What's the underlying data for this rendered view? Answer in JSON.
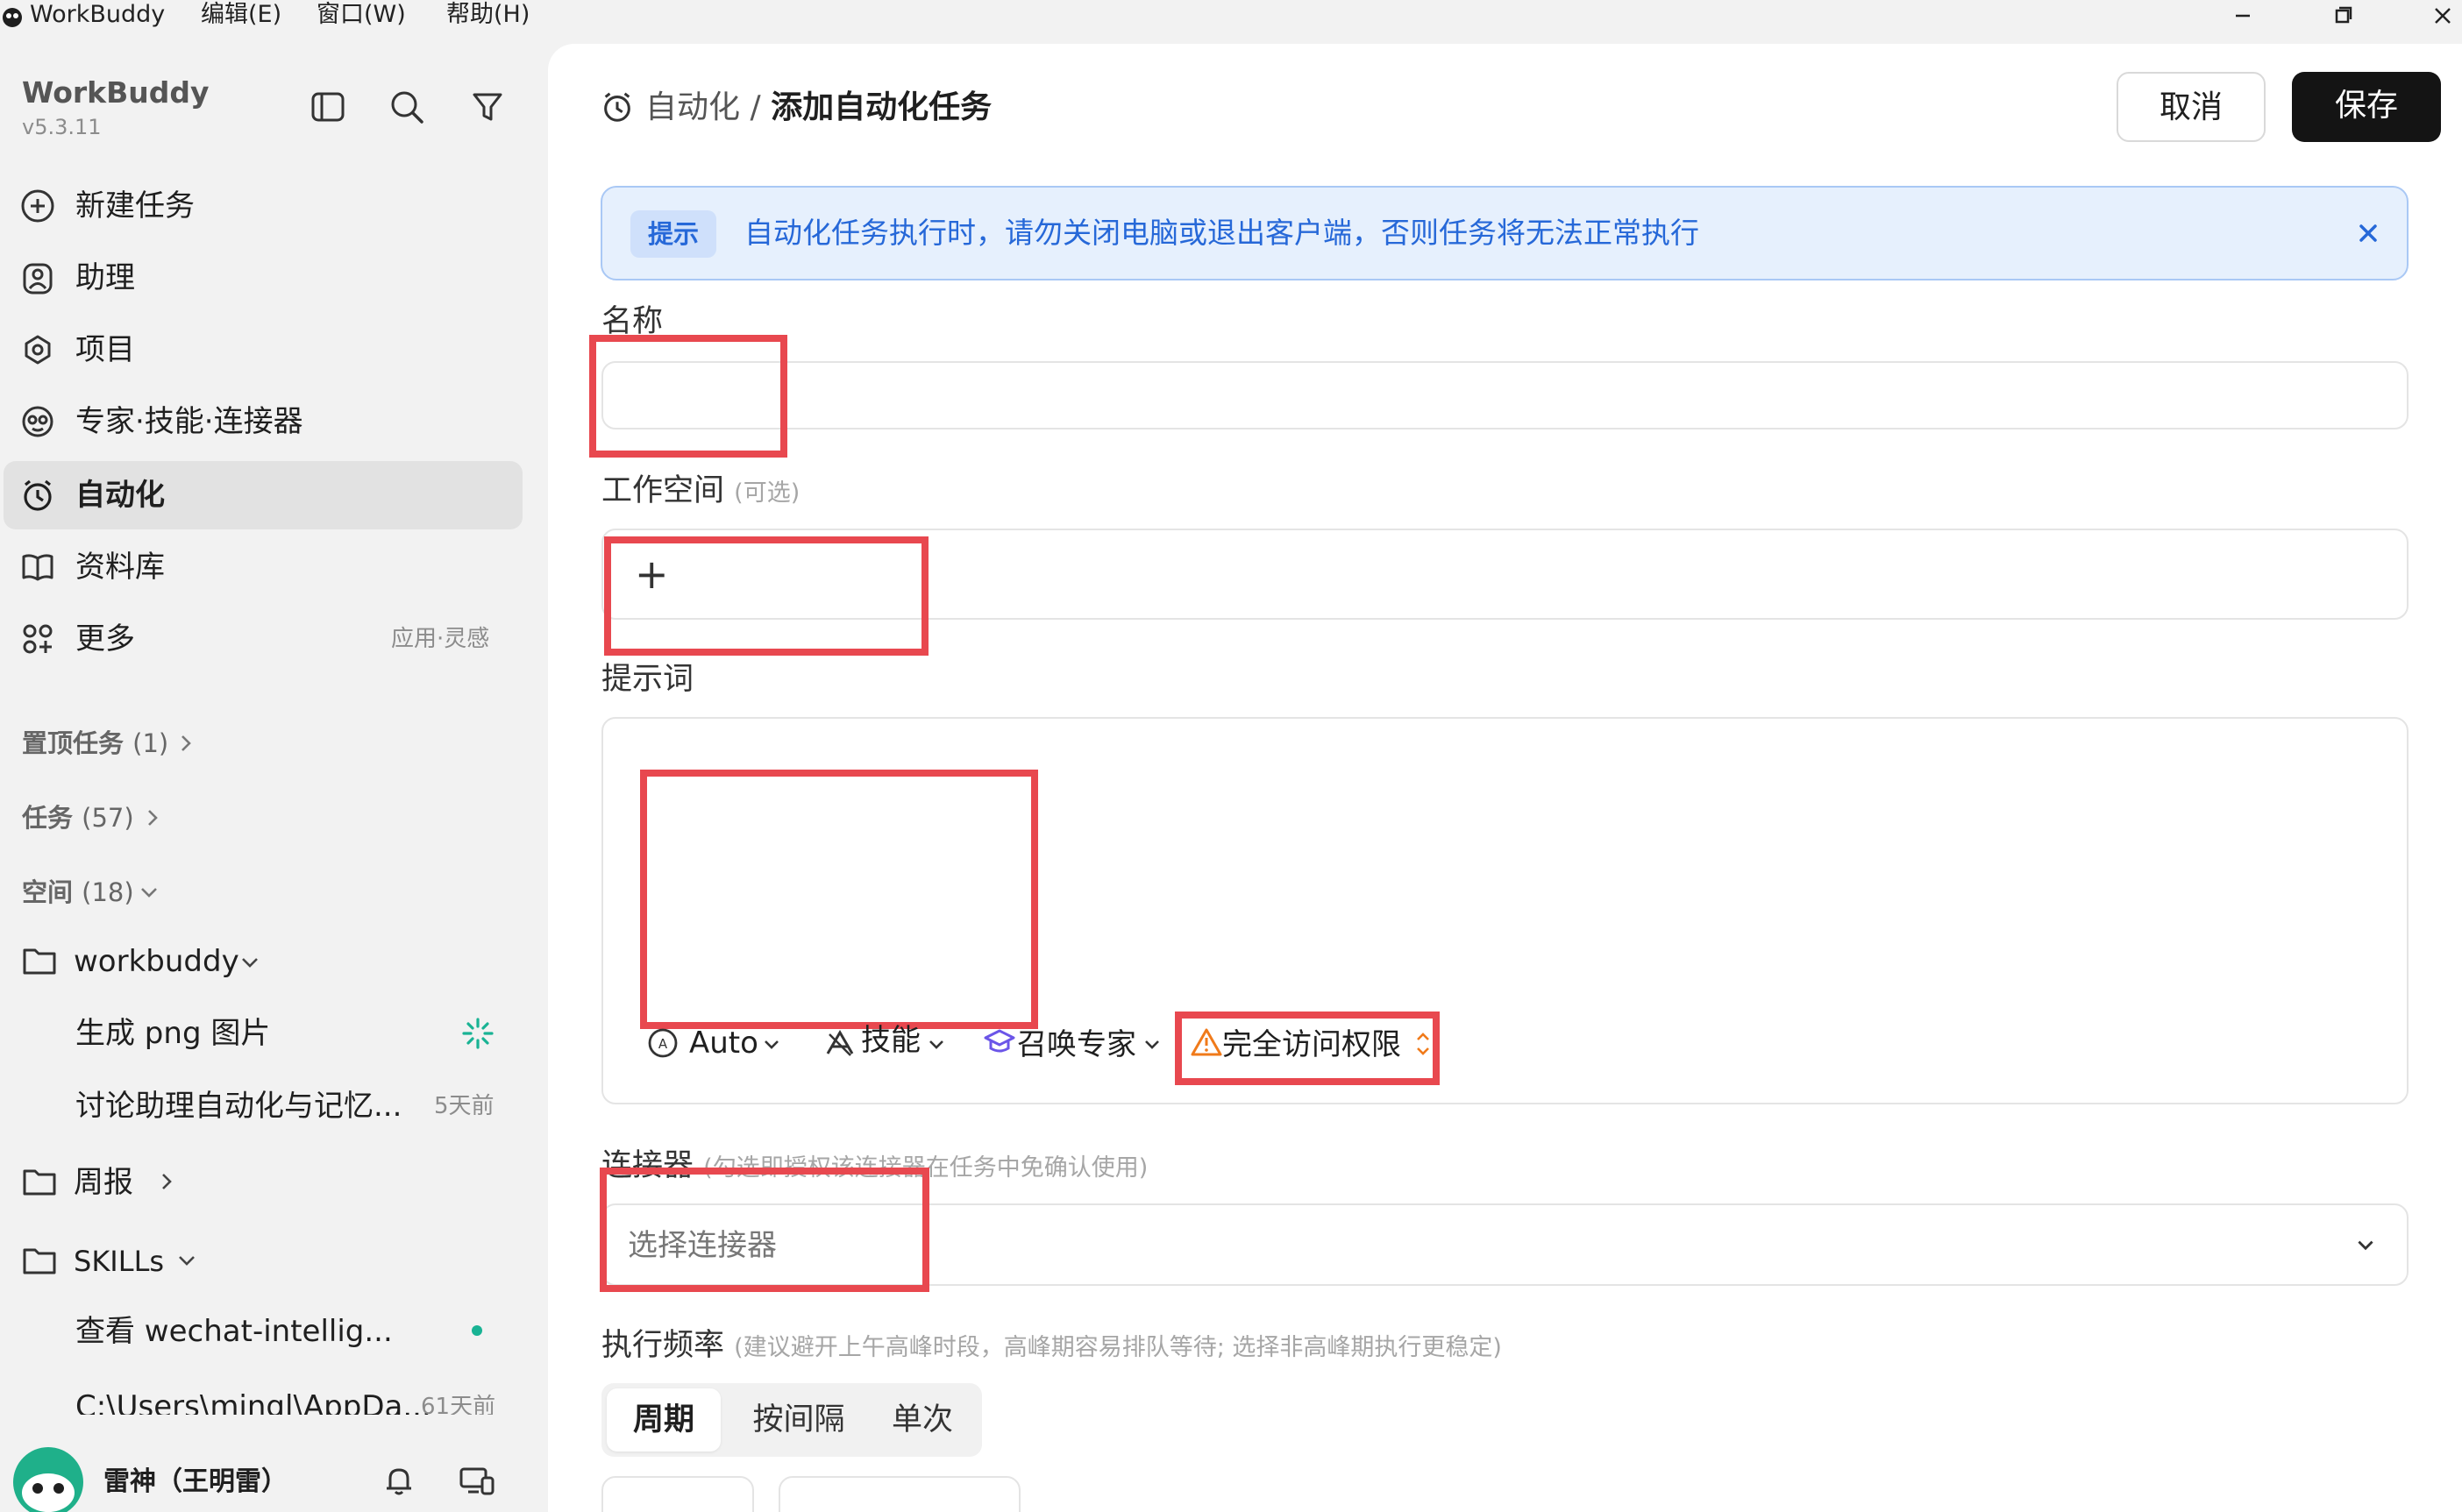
{
  "titlebar": {
    "app_name": "WorkBuddy",
    "menus": [
      "编辑(E)",
      "窗口(W)",
      "帮助(H)"
    ]
  },
  "sidebar": {
    "brand": "WorkBuddy",
    "version": "v5.3.11",
    "nav": [
      {
        "label": "新建任务",
        "icon": "plus-circle-icon"
      },
      {
        "label": "助理",
        "icon": "assistant-icon"
      },
      {
        "label": "项目",
        "icon": "project-icon"
      },
      {
        "label": "专家·技能·连接器",
        "icon": "expert-icon"
      },
      {
        "label": "自动化",
        "icon": "alarm-clock-icon",
        "active": true
      },
      {
        "label": "资料库",
        "icon": "book-icon"
      },
      {
        "label": "更多",
        "icon": "grid-icon",
        "meta": "应用·灵感"
      }
    ],
    "sections": {
      "pinned": {
        "label": "置顶任务",
        "count": "(1)"
      },
      "tasks": {
        "label": "任务",
        "count": "(57)"
      },
      "spaces": {
        "label": "空间",
        "count": "(18)"
      }
    },
    "tree": {
      "workbuddy": "workbuddy",
      "item1": "生成 png 图片",
      "item2": "讨论助理自动化与记忆...",
      "item2_time": "5天前",
      "weekly": "周报",
      "skills": "SKILLs",
      "item3": "查看 wechat-intellig...",
      "item4": "C:\\Users\\mingl\\AppDa...",
      "item4_time": "61天前"
    },
    "user": {
      "name": "雷神（王明雷）"
    }
  },
  "header": {
    "breadcrumb_parent": "自动化",
    "separator": "/",
    "title": "添加自动化任务",
    "cancel": "取消",
    "save": "保存"
  },
  "tip": {
    "badge": "提示",
    "text": "自动化任务执行时，请勿关闭电脑或退出客户端，否则任务将无法正常执行"
  },
  "form": {
    "name_label": "名称",
    "workspace_label": "工作空间",
    "workspace_hint": "(可选)",
    "workspace_add": "+",
    "prompt_label": "提示词",
    "toolbar": {
      "model": "Auto",
      "skills": "技能",
      "expert": "召唤专家",
      "access": "完全访问权限"
    },
    "connector_label": "连接器",
    "connector_hint": "(勾选即授权该连接器在任务中免确认使用)",
    "connector_placeholder": "选择连接器",
    "freq_label": "执行频率",
    "freq_hint": "(建议避开上午高峰时段，高峰期容易排队等待; 选择非高峰期执行更稳定)",
    "freq_tabs": [
      "周期",
      "按间隔",
      "单次"
    ]
  },
  "colors": {
    "accent_blue": "#2668d8",
    "highlight_red": "#e8484f",
    "save_bg": "#141414",
    "status_green": "#19b394"
  }
}
